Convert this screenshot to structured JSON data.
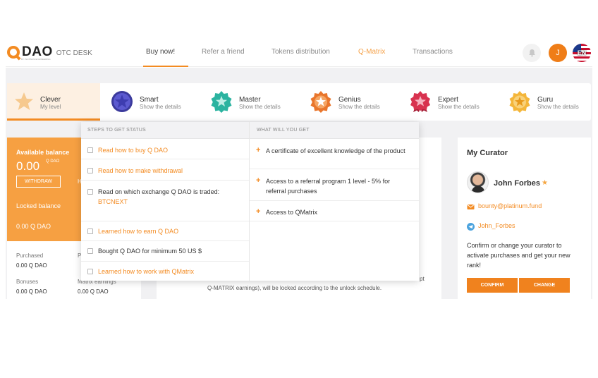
{
  "header": {
    "logo_word": "DAO",
    "logo_otc": "OTC DESK",
    "logo_tagline": "BY PLATINUM ENGINEERING",
    "nav": [
      {
        "label": "Buy now!",
        "state": "active"
      },
      {
        "label": "Refer a friend",
        "state": "normal"
      },
      {
        "label": "Tokens distribution",
        "state": "normal"
      },
      {
        "label": "Q-Matrix",
        "state": "accent"
      },
      {
        "label": "Transactions",
        "state": "normal"
      }
    ],
    "user_initial": "J",
    "language": "EN"
  },
  "levels": [
    {
      "name": "Clever",
      "sub": "My level",
      "icon": "star-badge-icon",
      "current": true
    },
    {
      "name": "Smart",
      "sub": "Show the details",
      "icon": "purple-star-badge-icon"
    },
    {
      "name": "Master",
      "sub": "Show the details",
      "icon": "teal-star-badge-icon"
    },
    {
      "name": "Genius",
      "sub": "Show the details",
      "icon": "orange-star-badge-icon"
    },
    {
      "name": "Expert",
      "sub": "Show the details",
      "icon": "red-ribbon-badge-icon"
    },
    {
      "name": "Guru",
      "sub": "Show the details",
      "icon": "gold-star-badge-icon"
    }
  ],
  "balance": {
    "label": "Available balance",
    "value": "0.00",
    "unit": "Q DAO",
    "withdraw_label": "WITHDRAW",
    "partial": "H",
    "locked_label": "Locked balance",
    "locked_value": "0.00 Q DAO"
  },
  "stats": {
    "purchased_label": "Purchased",
    "purchased_value": "0.00 Q DAO",
    "purchased_right_partial": "P",
    "bonuses_label": "Bonuses",
    "bonuses_value": "0.00 Q DAO",
    "matrix_label": "Matrix earnings",
    "matrix_value": "0.00 Q DAO"
  },
  "center": {
    "line1_tail": "pt",
    "line2": "Q-MATRIX earnings), will be locked according to the unlock schedule."
  },
  "dropdown": {
    "steps_header": "STEPS TO GET STATUS",
    "benefits_header": "WHAT WILL YOU GET",
    "steps": [
      {
        "text": "Read how to buy Q DAO",
        "link": true
      },
      {
        "text": "Read how to make withdrawal",
        "link": true
      },
      {
        "text": "Read on which exchange Q DAO is traded:",
        "link": false,
        "extra": "BTCNEXT"
      },
      {
        "text": "Learned how to earn Q DAO",
        "link": true
      },
      {
        "text": "Bought Q DAO for minimum 50 US $",
        "link": false
      },
      {
        "text": "Learned how to work with QMatrix",
        "link": true
      }
    ],
    "benefits": [
      "A certificate of excellent knowledge of the product",
      "Access to a referral program 1 level - 5% for referral purchases",
      "Access to QMatrix"
    ]
  },
  "curator": {
    "title": "My Curator",
    "name": "John Forbes",
    "email": "bounty@platinum.fund",
    "telegram": "John_Forbes",
    "description": "Confirm or change your curator to activate purchases and get your new rank!",
    "confirm_label": "CONFIRM",
    "change_label": "CHANGE"
  },
  "colors": {
    "accent": "#f38b22",
    "balance_card": "#f6a042",
    "button": "#f0821e"
  }
}
